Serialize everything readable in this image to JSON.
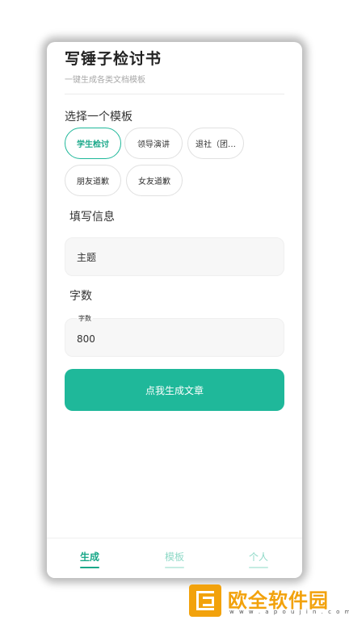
{
  "header": {
    "title": "写锤子检讨书",
    "subtitle": "一键生成各类文档模板"
  },
  "templates": {
    "section_title": "选择一个模板",
    "chips": [
      {
        "label": "学生检讨",
        "active": true
      },
      {
        "label": "领导演讲",
        "active": false
      },
      {
        "label": "退社（团…",
        "active": false
      },
      {
        "label": "朋友道歉",
        "active": false
      },
      {
        "label": "女友道歉",
        "active": false
      }
    ]
  },
  "form": {
    "section_title": "填写信息",
    "topic_placeholder": "主题",
    "word_count_title": "字数",
    "word_count_label": "字数",
    "word_count_value": "800"
  },
  "generate_button": {
    "label": "点我生成文章"
  },
  "tabbar": {
    "tabs": [
      {
        "label": "生成",
        "active": true
      },
      {
        "label": "模板",
        "active": false
      },
      {
        "label": "个人",
        "active": false
      }
    ]
  },
  "watermark": {
    "name": "欧全软件园",
    "url": "w w w . a p o u j i n . c o m"
  },
  "colors": {
    "accent": "#1fb89a",
    "accent_text": "#1aa889",
    "watermark": "#f2a20c"
  }
}
